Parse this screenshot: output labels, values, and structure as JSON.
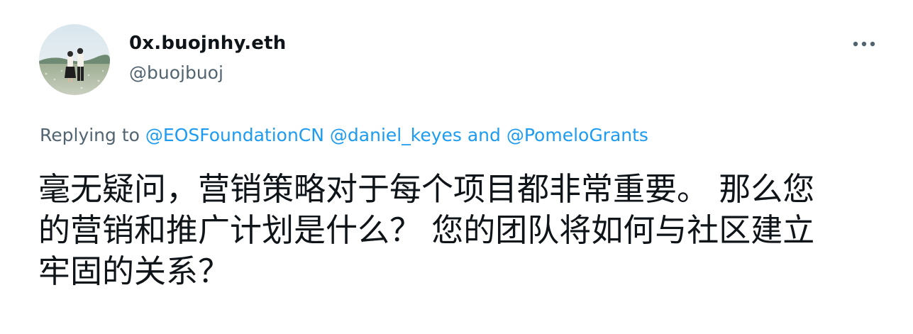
{
  "author": {
    "display_name": "0x.buojnhy.eth",
    "handle": "@buojbuoj",
    "avatar_icon": "profile-photo"
  },
  "menu": {
    "more_icon": "more-horizontal-icon"
  },
  "reply_context": {
    "prefix": "Replying to",
    "mentions": [
      "@EOSFoundationCN",
      "@daniel_keyes"
    ],
    "conjunction": "and",
    "last_mention": "@PomeloGrants"
  },
  "tweet": {
    "lines": [
      "毫无疑问，营销策略对于每个项目都非常重要。 那么您",
      "的营销和推广计划是什么？ 您的团队将如何与社区建立",
      "牢固的关系？"
    ]
  },
  "colors": {
    "text": "#0f1419",
    "secondary": "#536471",
    "link": "#1d9bf0"
  }
}
